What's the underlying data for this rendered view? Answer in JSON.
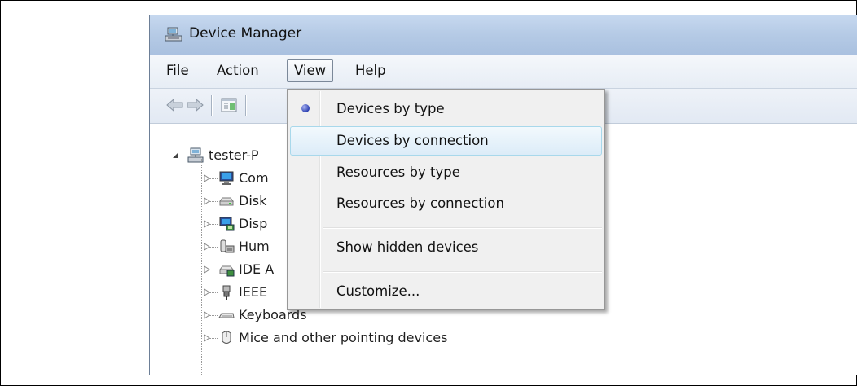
{
  "window": {
    "title": "Device Manager"
  },
  "menubar": {
    "file": "File",
    "action": "Action",
    "view": "View",
    "help": "Help"
  },
  "toolbar": {
    "buttons": [
      {
        "icon": "back-arrow-icon"
      },
      {
        "icon": "forward-arrow-icon"
      },
      {
        "icon": "properties-icon"
      }
    ]
  },
  "tree": {
    "root": {
      "label": "tester-P",
      "icon": "computer-network-icon",
      "expanded": true
    },
    "items": [
      {
        "label": "Com",
        "icon": "computer-monitor-icon"
      },
      {
        "label": "Disk",
        "icon": "disk-drive-icon"
      },
      {
        "label": "Disp",
        "icon": "display-adapter-icon"
      },
      {
        "label": "Hum",
        "icon": "human-interface-device-icon"
      },
      {
        "label": "IDE A",
        "icon": "ide-controller-icon"
      },
      {
        "label": "IEEE",
        "icon": "ieee1394-plug-icon"
      },
      {
        "label": "Keyboards",
        "icon": "keyboard-icon"
      },
      {
        "label": "Mice and other pointing devices",
        "icon": "mouse-icon"
      }
    ]
  },
  "view_menu": {
    "items": [
      {
        "label": "Devices by type",
        "checked": true
      },
      {
        "label": "Devices by connection",
        "highlighted": true
      },
      {
        "label": "Resources by type"
      },
      {
        "label": "Resources by connection"
      },
      {
        "label": "Show hidden devices"
      },
      {
        "label": "Customize..."
      }
    ]
  },
  "colors": {
    "titlebar": "#b6cbe6",
    "menu_background": "#f0f0f0",
    "hover_border": "#a8d8eb",
    "radio_dot": "#2b3fb0"
  }
}
